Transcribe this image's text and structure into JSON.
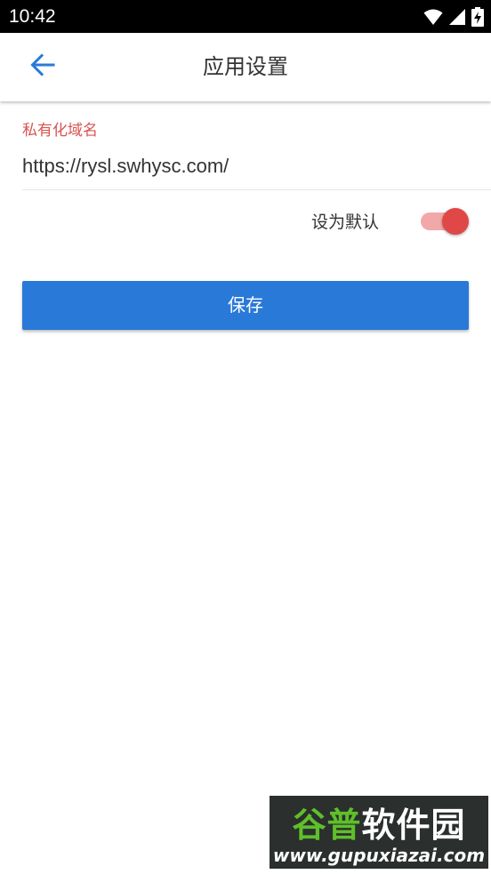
{
  "status_bar": {
    "time": "10:42",
    "icons": [
      "wifi-icon",
      "signal-icon",
      "battery-charging-icon"
    ]
  },
  "app_bar": {
    "back_icon": "arrow-left-icon",
    "title": "应用设置"
  },
  "form": {
    "domain_label": "私有化域名",
    "domain_value": "https://rysl.swhysc.com/",
    "default_label": "设为默认",
    "default_enabled": true,
    "save_label": "保存"
  },
  "watermark": {
    "part1": "谷普",
    "part2": "软件园",
    "url": "www.gupuxiazai.com"
  },
  "colors": {
    "accent": "#2979d8",
    "label_red": "#d9534f",
    "toggle_thumb": "#e04848",
    "toggle_track": "#f2a8a8"
  }
}
